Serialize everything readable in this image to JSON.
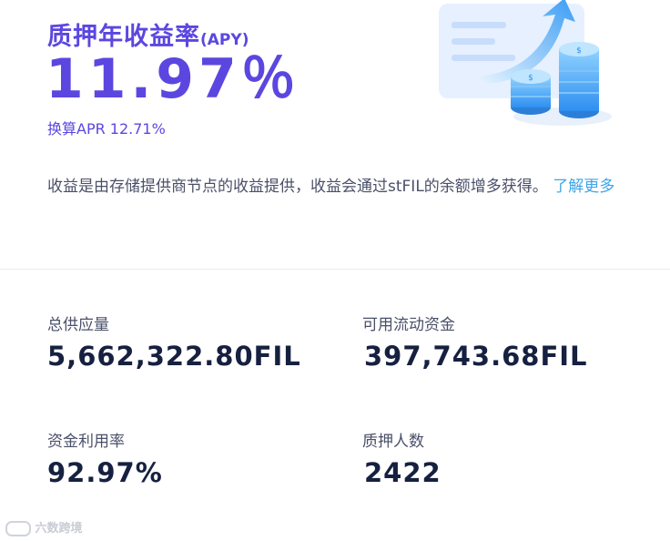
{
  "hero": {
    "title": "质押年收益率",
    "title_suffix": "(APY)",
    "rate": "11.97％",
    "apr": "换算APR 12.71%",
    "illustration_icon": "coins-growth-arrow-icon"
  },
  "description": {
    "text": "收益是由存储提供商节点的收益提供，收益会通过stFIL的余额增多获得。",
    "learn_more": "了解更多"
  },
  "stats": {
    "total_supply_label": "总供应量",
    "total_supply_value": "5,662,322.80FIL",
    "available_liquidity_label": "可用流动资金",
    "available_liquidity_value": "397,743.68FIL",
    "utilization_label": "资金利用率",
    "utilization_value": "92.97%",
    "stakers_label": "质押人数",
    "stakers_value": "2422"
  },
  "watermark": {
    "text": "六数跨境",
    "icon": "watermark-logo-icon"
  },
  "colors": {
    "accent": "#5b47e0",
    "link": "#3fa4e8",
    "value": "#162040",
    "label": "#4a5068"
  }
}
